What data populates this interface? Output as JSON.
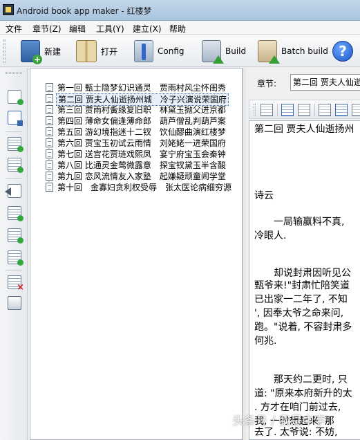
{
  "window": {
    "title": "Android book app maker - 红楼梦"
  },
  "menu": [
    "文件",
    "章节(Z)",
    "编辑",
    "工具(Y)",
    "建立(X)",
    "帮助"
  ],
  "toolbar": {
    "new_label": "新建",
    "open_label": "打开",
    "config_label": "Config",
    "build_label": "Build",
    "batch_label": "Batch build",
    "help_icon_text": "?"
  },
  "chapters": [
    "第一回 甄士隐梦幻识通灵　贾雨村风尘怀闺秀",
    "第二回 贾夫人仙逝扬州城　冷子兴演说荣国府",
    "第三回 贾雨村夤缘复旧职　林黛玉抛父进京都",
    "第四回 薄命女偏逢薄命郎　葫芦僧乱判葫芦案",
    "第五回 游幻境指迷十二钗　饮仙醪曲演红楼梦",
    "第六回 贾宝玉初试云雨情　刘姥姥一进荣国府",
    "第七回 送宫花贾琏戏熙凤　宴宁府宝玉会秦钟",
    "第八回 比通灵金莺微露意　探宝钗黛玉半含酸",
    "第九回 恋风流情友入家塾　起嫌疑顽童闹学堂",
    "第十回　金寡妇贪利权受辱　张太医论病细穷源"
  ],
  "selected_index": 1,
  "editor": {
    "chapter_label": "章节:",
    "chapter_value": "第二回 贾夫人仙逝扬州城",
    "lines": [
      "第二回 贾夫人仙逝扬州",
      "",
      "",
      "诗云",
      "",
      "　　一局输赢料不真,",
      "冷眼人.",
      "",
      "",
      "　　却说封肃因听见公",
      "甄爷来!\"封肃忙陪笑道",
      "已出家一二年了, 不知",
      "', 因奉太爷之命来问,",
      "跑。\"说着, 不容封肃多",
      "何兆.",
      "",
      "",
      "　　那天约二更时, 只",
      "道: \"原来本府新升的太",
      ". 方才在咱门前过去,",
      "我, 一时想起来, 那",
      "去了. 太爷说: 不妨,"
    ]
  },
  "watermark": "头条号 / 我是中宇"
}
